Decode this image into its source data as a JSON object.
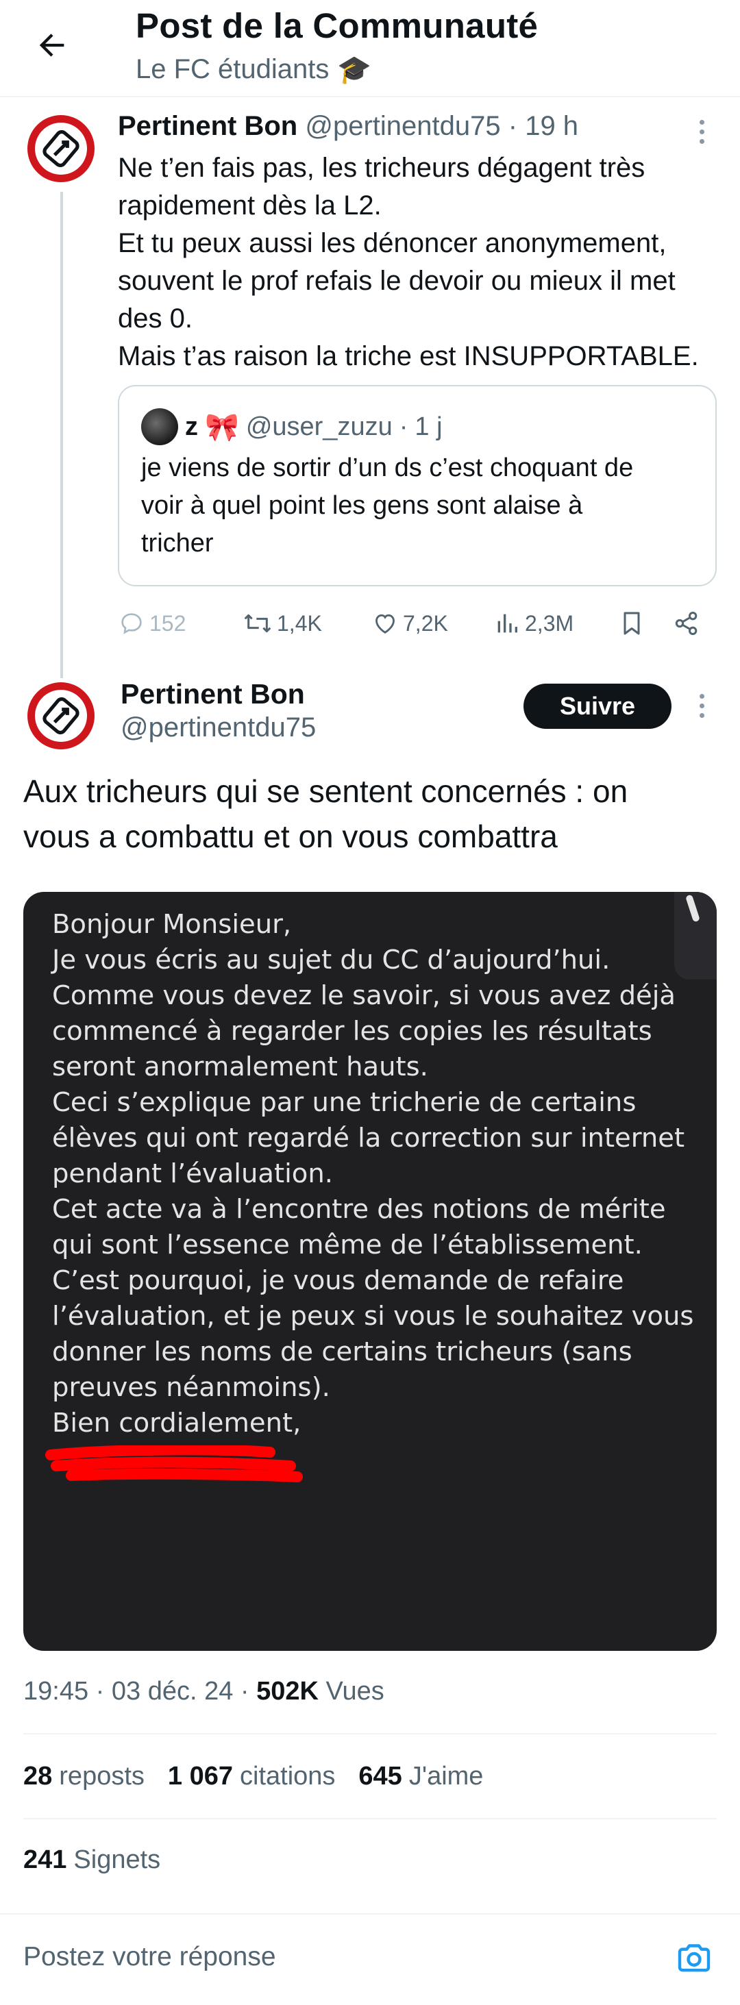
{
  "header": {
    "title": "Post de la Communauté",
    "community": "Le FC étudiants",
    "community_emoji": "🎓"
  },
  "reply_tweet": {
    "name": "Pertinent Bon",
    "handle": "@pertinentdu75",
    "time": "19 h",
    "lines": [
      "Ne t’en fais pas, les tricheurs dégagent très",
      "rapidement dès la L2.",
      "Et tu peux aussi les dénoncer anonymement,",
      "souvent le prof refais le devoir ou mieux il met",
      "des 0.",
      "Mais t’as raison la triche est INSUPPORTABLE."
    ],
    "quote": {
      "name": "z",
      "emoji": "🎀",
      "handle": "@user_zuzu",
      "time": "1 j",
      "lines": [
        "je viens de sortir d’un ds c’est choquant de",
        "voir à quel point les gens sont alaise à",
        "tricher"
      ]
    },
    "actions": {
      "replies": "152",
      "reposts": "1,4K",
      "likes": "7,2K",
      "views": "2,3M"
    }
  },
  "main_tweet": {
    "name": "Pertinent Bon",
    "handle": "@pertinentdu75",
    "follow_label": "Suivre",
    "text_lines": [
      "Aux tricheurs qui se sentent concernés : on",
      "vous a combattu et on vous combattra"
    ],
    "image_text_lines": [
      "Bonjour Monsieur,",
      "Je vous écris au sujet du CC d’aujourd’hui.",
      "Comme vous devez le savoir, si vous avez déjà",
      "commencé  à regarder les copies les résultats",
      "seront anormalement hauts.",
      "Ceci s’explique par une tricherie de certains",
      "élèves qui ont regardé la correction sur internet",
      "pendant l’évaluation.",
      "Cet acte va à l’encontre des notions de mérite",
      "qui sont l’essence même de l’établissement.",
      "C’est pourquoi, je vous demande de refaire",
      "l’évaluation, et je peux si vous le souhaitez vous",
      "donner les noms de certains tricheurs (sans",
      "preuves néanmoins).",
      "Bien cordialement,"
    ],
    "time": "19:45",
    "date": "03 déc. 24",
    "views_count": "502K",
    "views_label": "Vues",
    "reposts_count": "28",
    "reposts_label": "reposts",
    "quotes_count": "1 067",
    "quotes_label": "citations",
    "likes_count": "645",
    "likes_label": "J'aime",
    "bookmarks_count": "241",
    "bookmarks_label": "Signets"
  },
  "reply_bar": {
    "placeholder": "Postez votre réponse"
  },
  "colors": {
    "avatar_red": "#d0161d",
    "accent_blue": "#1d9bf0",
    "follow_bg": "#0f1419",
    "image_bg": "#1f1f22",
    "redaction": "#ff0000"
  },
  "icons": {
    "back": "arrow-left-icon",
    "reply": "speech-bubble-icon",
    "repost": "repost-arrows-icon",
    "like": "heart-icon",
    "views": "bar-chart-icon",
    "bookmark": "bookmark-icon",
    "share": "share-icon",
    "camera": "camera-icon",
    "more": "kebab-menu-icon"
  }
}
